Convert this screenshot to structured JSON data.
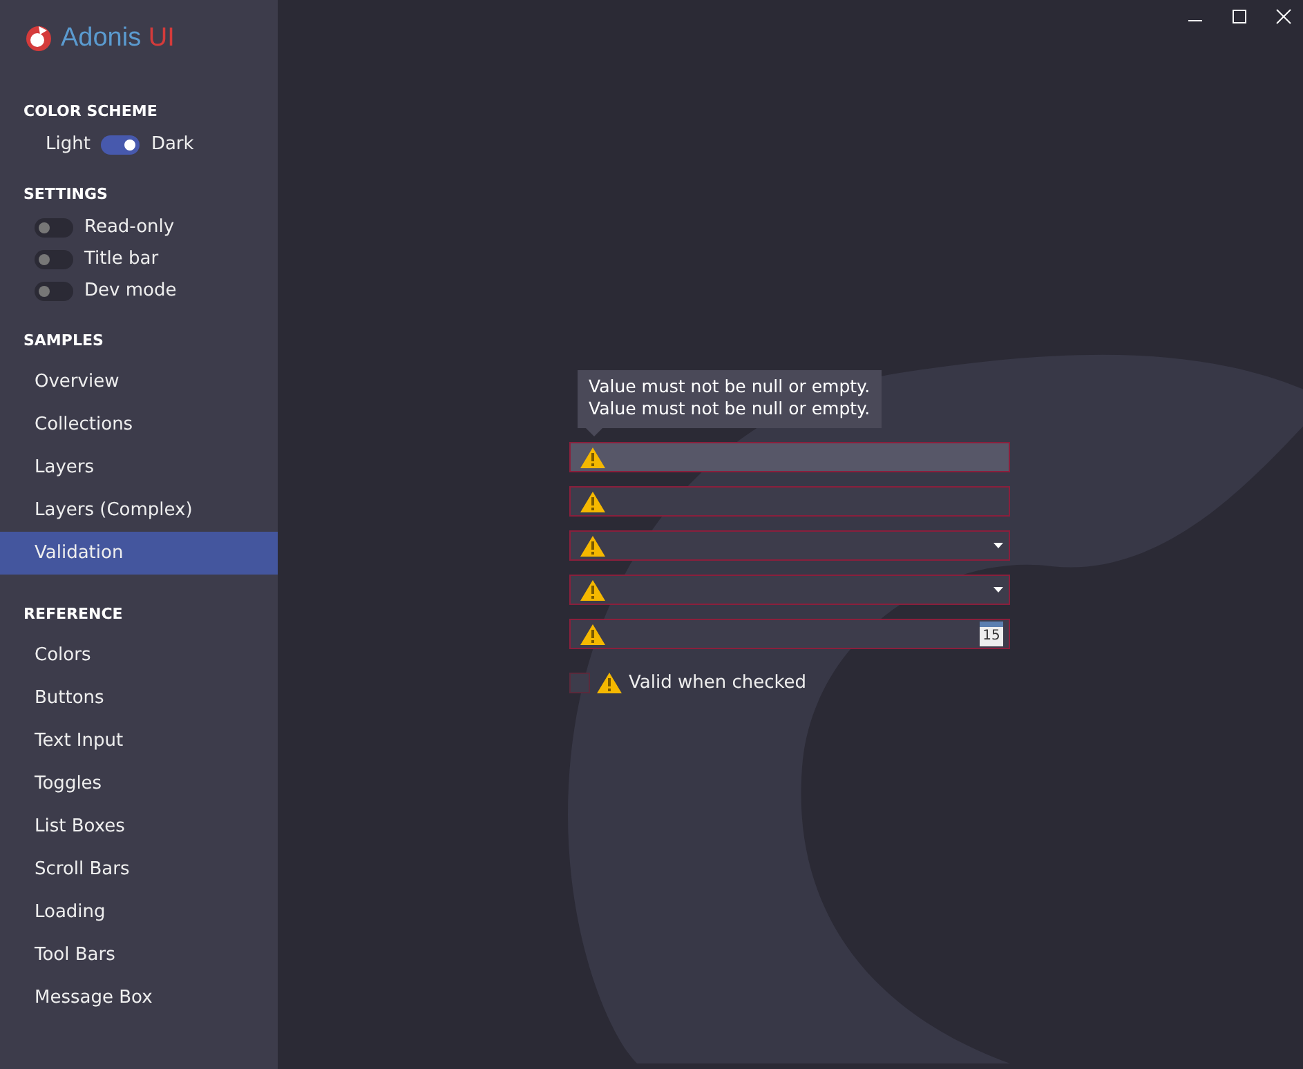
{
  "app": {
    "name_part_1": "Adonis",
    "name_part_2": "UI"
  },
  "color_scheme": {
    "heading": "COLOR SCHEME",
    "left_label": "Light",
    "right_label": "Dark",
    "on": true
  },
  "settings": {
    "heading": "SETTINGS",
    "toggles": [
      {
        "label": "Read-only",
        "on": false
      },
      {
        "label": "Title bar",
        "on": false
      },
      {
        "label": "Dev mode",
        "on": false
      }
    ]
  },
  "samples": {
    "heading": "SAMPLES",
    "items": [
      {
        "label": "Overview",
        "selected": false
      },
      {
        "label": "Collections",
        "selected": false
      },
      {
        "label": "Layers",
        "selected": false
      },
      {
        "label": "Layers (Complex)",
        "selected": false
      },
      {
        "label": "Validation",
        "selected": true
      }
    ]
  },
  "reference": {
    "heading": "REFERENCE",
    "items": [
      {
        "label": "Colors",
        "selected": false
      },
      {
        "label": "Buttons",
        "selected": false
      },
      {
        "label": "Text Input",
        "selected": false
      },
      {
        "label": "Toggles",
        "selected": false
      },
      {
        "label": "List Boxes",
        "selected": false
      },
      {
        "label": "Scroll Bars",
        "selected": false
      },
      {
        "label": "Loading",
        "selected": false
      },
      {
        "label": "Tool Bars",
        "selected": false
      },
      {
        "label": "Message Box",
        "selected": false
      }
    ]
  },
  "tooltip": {
    "lines": [
      "Value must not be null or empty.",
      "Value must not be null or empty."
    ]
  },
  "fields": [
    {
      "kind": "text",
      "focused": true
    },
    {
      "kind": "text",
      "focused": false
    },
    {
      "kind": "combo",
      "focused": false
    },
    {
      "kind": "combo",
      "focused": false
    },
    {
      "kind": "date",
      "focused": false,
      "day": "15"
    }
  ],
  "checkbox": {
    "label": "Valid when checked",
    "checked": false
  }
}
